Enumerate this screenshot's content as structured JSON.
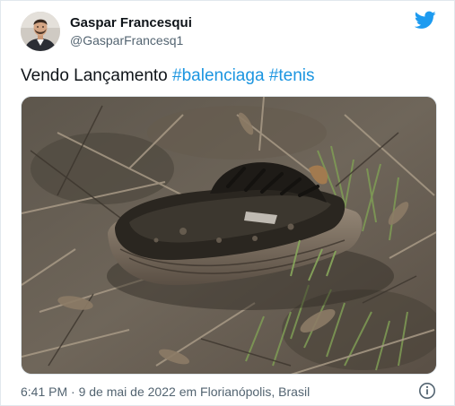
{
  "tweet": {
    "author": {
      "display_name": "Gaspar Francesqui",
      "handle": "@GasparFrancesq1",
      "avatar_icon": "profile-photo"
    },
    "text": {
      "prefix": "Vendo Lançamento",
      "hashtags": [
        "#balenciaga",
        "#tenis"
      ]
    },
    "media": {
      "kind": "photo",
      "icon": "burnt-shoe-photo"
    },
    "footer": {
      "time": "6:41 PM",
      "separator": "·",
      "date": "9 de mai de 2022",
      "location_prefix": "em",
      "location": "Florianópolis, Brasil"
    },
    "icons": {
      "brand": "twitter-bird-icon",
      "info": "info-icon"
    }
  },
  "colors": {
    "brand": "#1d9bf0",
    "hashtag": "#1b95e0",
    "secondary_text": "#536471",
    "border": "#e1e8ed"
  }
}
